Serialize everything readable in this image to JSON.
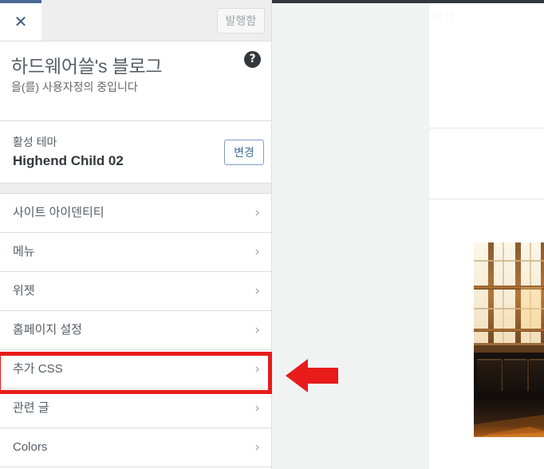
{
  "window": {
    "app": "WordPress Customizer",
    "accent_color": "#4a6a95",
    "annotation_color": "#e81b1b"
  },
  "actions_bar": {
    "close_icon": "close-x-icon",
    "close_label": "✕",
    "publish_label": "발행함",
    "publish_disabled": true
  },
  "site_header": {
    "title": "하드웨어쓸's 블로그",
    "subtitle": "을(를) 사용자정의 중입니다",
    "help_icon": "question-mark-icon",
    "help_label": "?"
  },
  "theme_panel": {
    "active_label": "활성 테마",
    "theme_name": "Highend Child 02",
    "change_label": "변경"
  },
  "sections": [
    {
      "label": "사이트 아이덴티티",
      "name": "sidebar-item-site-identity",
      "chevron": "›",
      "highlighted": false
    },
    {
      "label": "메뉴",
      "name": "sidebar-item-menus",
      "chevron": "›",
      "highlighted": false
    },
    {
      "label": "위젯",
      "name": "sidebar-item-widgets",
      "chevron": "›",
      "highlighted": false
    },
    {
      "label": "홈페이지 설정",
      "name": "sidebar-item-homepage-settings",
      "chevron": "›",
      "highlighted": false
    },
    {
      "label": "추가 CSS",
      "name": "sidebar-item-additional-css",
      "chevron": "›",
      "highlighted": true
    },
    {
      "label": "관련 글",
      "name": "sidebar-item-related-posts",
      "chevron": "›",
      "highlighted": false
    },
    {
      "label": "Colors",
      "name": "sidebar-item-colors",
      "chevron": "›",
      "highlighted": false
    }
  ],
  "preview": {
    "faint_title": "리뷰",
    "photo_alt": "warm-lit-room-with-shoji-windows"
  },
  "annotation": {
    "arrow_direction": "left",
    "arrow_icon": "left-arrow-icon",
    "highlight_target": "추가 CSS"
  }
}
